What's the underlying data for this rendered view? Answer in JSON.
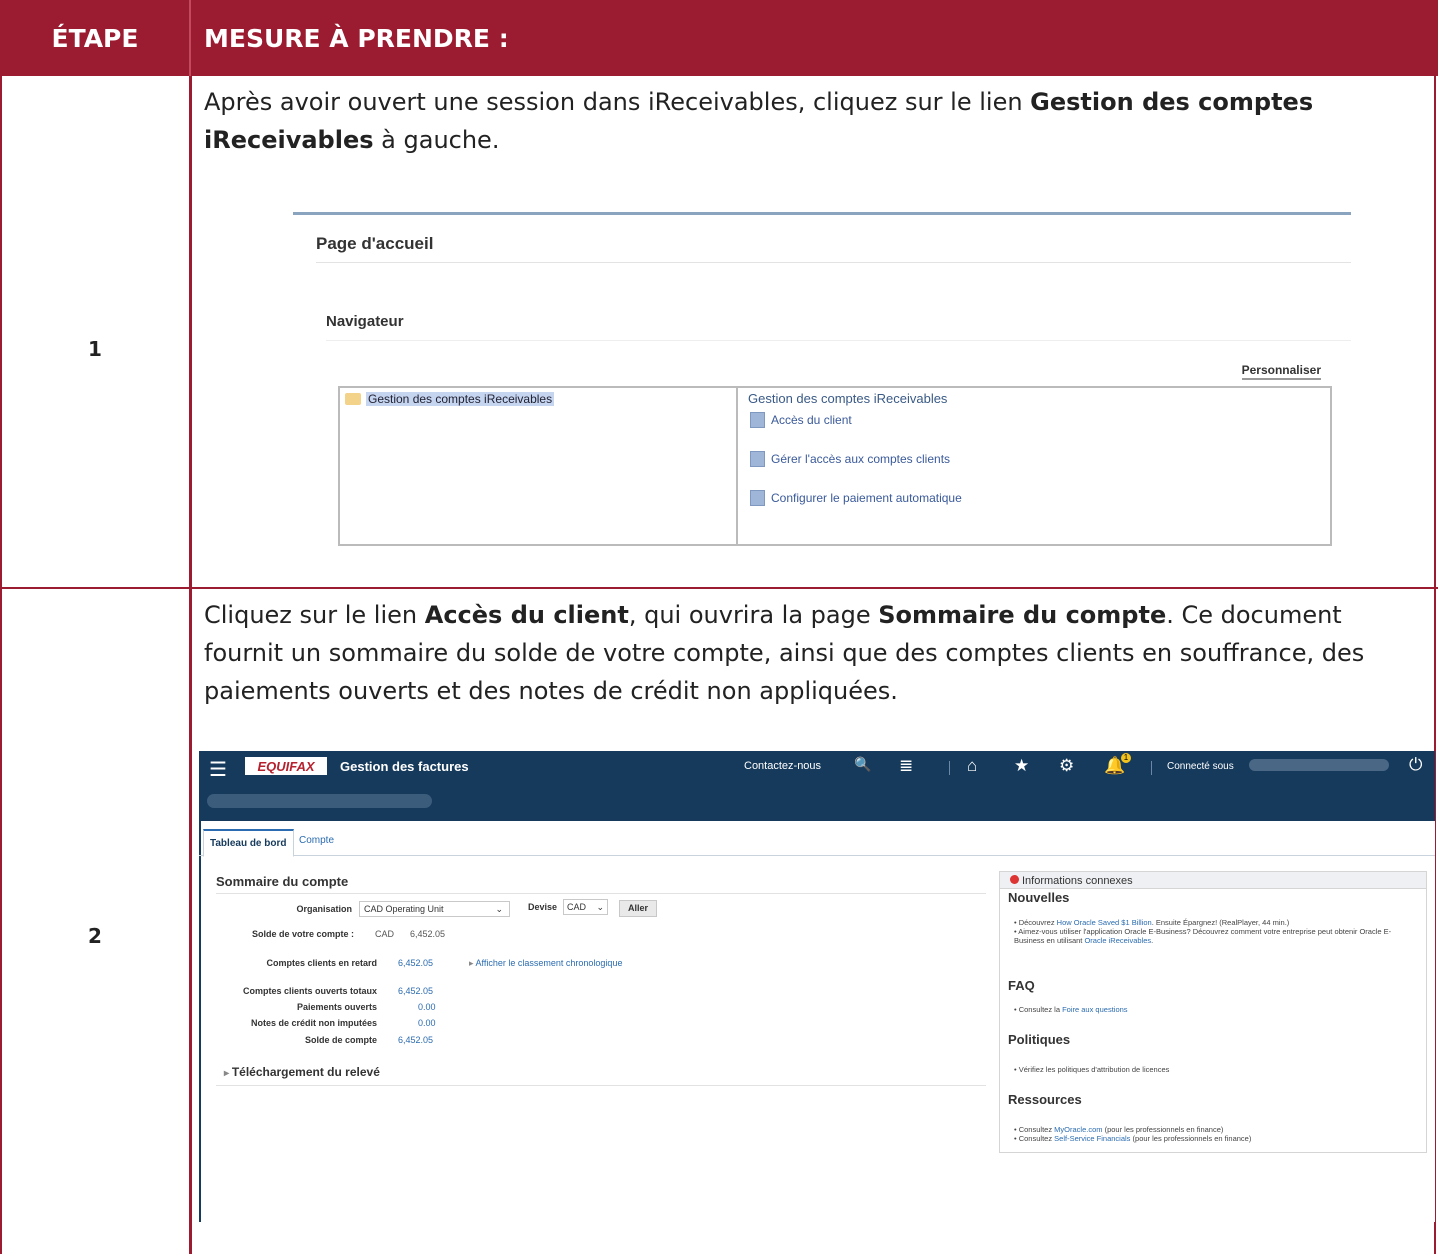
{
  "header": {
    "col1": "ÉTAPE",
    "col2": "MESURE À PRENDRE :"
  },
  "rows": [
    {
      "step": "1",
      "text_before": "Après avoir ouvert une session dans iReceivables, cliquez sur le lien ",
      "text_bold": "Gestion des comptes iReceivables",
      "text_after": " à gauche."
    },
    {
      "step": "2",
      "t1": "Cliquez sur le lien ",
      "b1": "Accès du client",
      "t2": ", qui ouvrira la page ",
      "b2": "Sommaire du compte",
      "t3": ". Ce document fournit un sommaire du solde de votre compte, ainsi que des comptes clients en souffrance, des paiements ouverts et des notes de crédit non appliquées."
    }
  ],
  "shot1": {
    "page_title": "Page d'accueil",
    "navigator": "Navigateur",
    "personalize": "Personnaliser",
    "selected_item": "Gestion des comptes iReceivables",
    "right_heading": "Gestion des comptes iReceivables",
    "links": [
      "Accès du client",
      "Gérer l'accès aux comptes clients",
      "Configurer le paiement automatique"
    ]
  },
  "shot2": {
    "logo": "EQUIFAX",
    "app_title": "Gestion des factures",
    "contact": "Contactez-nous",
    "notif_count": "1",
    "connected": "Connecté sous",
    "tabs": [
      "Tableau de bord",
      "Compte"
    ],
    "summary_title": "Sommaire du compte",
    "org_label": "Organisation",
    "org_value": "CAD Operating Unit",
    "currency_label": "Devise",
    "currency_value": "CAD",
    "go_button": "Aller",
    "balance_label": "Solde de votre compte :",
    "balance_currency": "CAD",
    "balance_value": "6,452.05",
    "overdue_label": "Comptes clients en retard",
    "overdue_value": "6,452.05",
    "aging_link": "Afficher le classement chronologique",
    "total_open_label": "Comptes clients ouverts totaux",
    "total_open_value": "6,452.05",
    "open_payments_label": "Paiements ouverts",
    "open_payments_value": "0.00",
    "credit_notes_label": "Notes de crédit non imputées",
    "credit_notes_value": "0.00",
    "account_balance_label": "Solde de compte",
    "account_balance_value": "6,452.05",
    "download": "Téléchargement du relevé",
    "related_title": "Informations connexes",
    "news_title": "Nouvelles",
    "news_1a": "Découvrez ",
    "news_1link": "How Oracle Saved $1 Billion",
    "news_1b": ". Ensuite Épargnez! (RealPlayer, 44 min.)",
    "news_2a": "Aimez-vous utiliser l'application Oracle E-Business? Découvrez comment votre entreprise peut obtenir Oracle E-Business en utilisant ",
    "news_2link": "Oracle iReceivables",
    "news_2b": ".",
    "faq_title": "FAQ",
    "faq_a": "Consultez la ",
    "faq_link": "Foire aux questions",
    "policies_title": "Politiques",
    "policies_text": "Vérifiez les politiques d'attribution de licences",
    "resources_title": "Ressources",
    "res_1a": "Consultez ",
    "res_1link": "MyOracle.com",
    "res_1b": " (pour les professionnels en finance)",
    "res_2a": "Consultez ",
    "res_2link": "Self-Service Financials",
    "res_2b": " (pour les professionnels en finance)"
  }
}
